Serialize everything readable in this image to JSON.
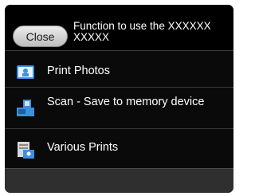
{
  "header": {
    "close_label": "Close",
    "title": "Function to use the XXXXXX XXXXX"
  },
  "menu": {
    "items": [
      {
        "label": "Print Photos",
        "icon": "photo-print-icon"
      },
      {
        "label": "Scan - Save to memory device",
        "icon": "scan-to-memory-icon"
      },
      {
        "label": "Various Prints",
        "icon": "various-prints-icon"
      }
    ]
  },
  "colors": {
    "background": "#000000",
    "accent_icon": "#3d8fe0",
    "empty_row": "#2f2f2f"
  }
}
